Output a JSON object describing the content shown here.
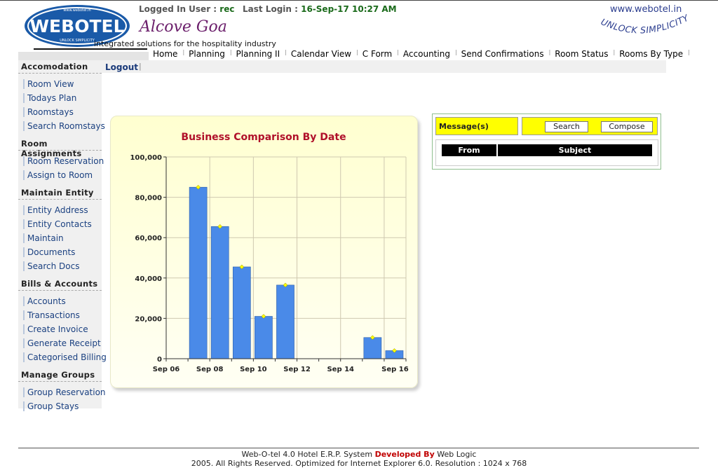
{
  "header": {
    "logged_in_label": "Logged In User :",
    "logged_in_user": "rec",
    "last_login_label": "Last Login :",
    "last_login_value": "16-Sep-17 10:27 AM",
    "hotel_name": "Alcove Goa",
    "tagline": "integrated solutions for the hospitality industry",
    "logo_text": "WEBOTEL",
    "logo_small_top": "www.webotel.in",
    "logo_small_bottom": "UNLOCK SIMPLICITY",
    "site_url": "www.webotel.in",
    "unlock_text": "UNLOCK SIMPLICITY"
  },
  "menu": [
    "Home",
    "Planning",
    "Planning II",
    "Calendar View",
    "C Form",
    "Accounting",
    "Send Confirmations",
    "Room Status",
    "Rooms By Type"
  ],
  "subbar": {
    "logout": "Logout"
  },
  "sidebar": [
    {
      "title": "Accomodation",
      "items": [
        "Room View",
        "Todays Plan",
        "Roomstays",
        "Search Roomstays"
      ]
    },
    {
      "title": "Room Assignments",
      "items": [
        "Room Reservation",
        "Assign to Room"
      ]
    },
    {
      "title": "Maintain Entity",
      "items": [
        "Entity Address",
        "Entity Contacts",
        "Maintain",
        "Documents",
        "Search Docs"
      ]
    },
    {
      "title": "Bills & Accounts",
      "items": [
        "Accounts",
        "Transactions",
        "Create Invoice",
        "Generate Receipt",
        "Categorised Billing"
      ]
    },
    {
      "title": "Manage Groups",
      "items": [
        "Group Reservation",
        "Group Stays"
      ]
    }
  ],
  "chart_data": {
    "type": "bar",
    "title": "Business Comparison By Date",
    "x_tick_labels": [
      "Sep 06",
      "Sep 08",
      "Sep 10",
      "Sep 12",
      "Sep 14",
      "Sep 16"
    ],
    "y_tick_labels": [
      "0",
      "20,000",
      "40,000",
      "60,000",
      "80,000",
      "100,000"
    ],
    "categories": [
      "Sep 06",
      "Sep 07",
      "Sep 08",
      "Sep 09",
      "Sep 10",
      "Sep 11",
      "Sep 12",
      "Sep 13",
      "Sep 14",
      "Sep 15",
      "Sep 16"
    ],
    "values": [
      0,
      85000,
      65500,
      45500,
      21000,
      36500,
      0,
      0,
      0,
      10500,
      4000
    ],
    "ylim": [
      0,
      100000
    ],
    "grid": true,
    "bar_color": "#4a8ae8",
    "marker_color": "#ffff00"
  },
  "messages": {
    "label": "Message(s)",
    "search_button": "Search",
    "compose_button": "Compose",
    "columns": [
      "From",
      "Subject"
    ]
  },
  "footer": {
    "line1_a": "Web-O-tel 4.0 Hotel E.R.P. System",
    "line1_b": "Developed By",
    "line1_c": "Web Logic",
    "line2": "2005. All Rights Reserved. Optimized for Internet Explorer 6.0.  Resolution : 1024 x 768"
  }
}
